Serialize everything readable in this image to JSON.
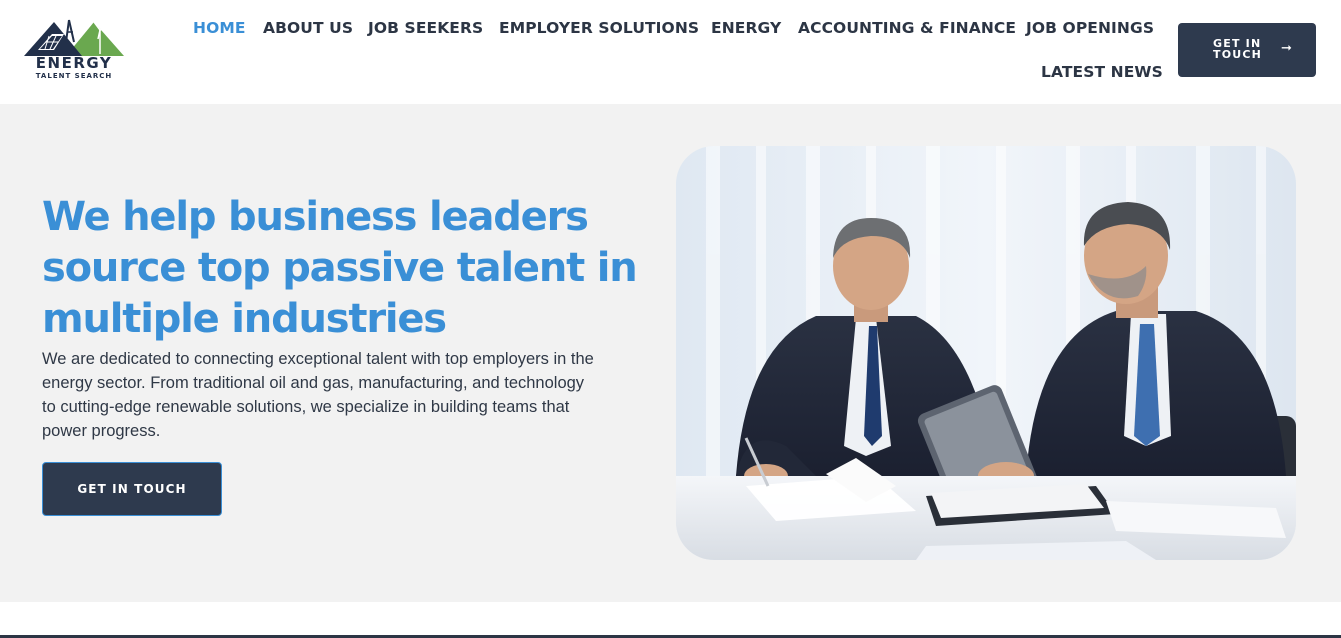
{
  "logo": {
    "word": "ENERGY",
    "subtitle": "TALENT SEARCH",
    "icon": "mountain-solar-wind-logo"
  },
  "nav": {
    "items": [
      {
        "label": "HOME",
        "active": true
      },
      {
        "label": "ABOUT US",
        "active": false
      },
      {
        "label": "JOB SEEKERS",
        "active": false
      },
      {
        "label": "EMPLOYER SOLUTIONS",
        "active": false
      },
      {
        "label": "ENERGY",
        "active": false
      },
      {
        "label": "ACCOUNTING & FINANCE",
        "active": false
      },
      {
        "label": "JOB OPENINGS",
        "active": false
      },
      {
        "label": "LATEST NEWS",
        "active": false
      }
    ],
    "cta": {
      "line1": "GET IN",
      "line2": "TOUCH",
      "icon": "arrow-right-icon"
    }
  },
  "hero": {
    "headline": [
      "We help business leaders",
      "source top passive talent in",
      "multiple industries"
    ],
    "description": [
      "We are dedicated to connecting exceptional talent with top employers in the",
      "energy sector. From traditional oil and gas, manufacturing, and technology",
      "to cutting-edge renewable solutions, we specialize in building teams that",
      "power progress."
    ],
    "cta": "GET IN TOUCH",
    "image": "two-businessmen-reviewing-documents-photo"
  },
  "colors": {
    "accent": "#3a8fd6",
    "dark": "#2e3a4e",
    "hero_bg": "#f2f2f2"
  }
}
